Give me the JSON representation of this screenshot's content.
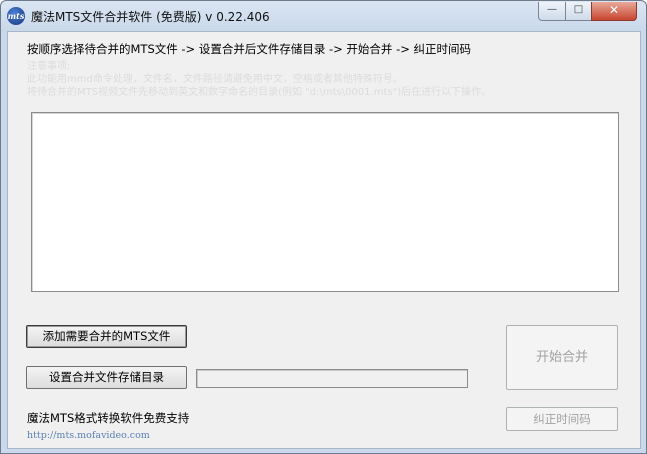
{
  "window": {
    "title": "魔法MTS文件合并软件 (免费版) v 0.22.406",
    "icon": "mts-logo-icon",
    "icon_text": "mts",
    "controls": {
      "minimize_glyph": "—",
      "maximize_glyph": "□",
      "close_glyph": "✕"
    }
  },
  "main": {
    "instructions": "按顺序选择待合并的MTS文件 -> 设置合并后文件存储目录  -> 开始合并 -> 纠正时间码",
    "notes": [
      "注意事项:",
      "此功能用mmd命令处理，文件名，文件路径请避免用中文，空格或者其他特殊符号。",
      "将待合并的MTS视频文件先移动到英文和数字命名的目录(例如 \"d:\\mts\\0001.mts\")后在进行以下操作。"
    ],
    "log": ""
  },
  "buttons": {
    "add_files": "添加需要合并的MTS文件",
    "set_dir": "设置合并文件存储目录",
    "start": "开始合并",
    "fix_timecode": "纠正时间码"
  },
  "output_path": {
    "value": ""
  },
  "footer": {
    "support": "魔法MTS格式转换软件免费支持",
    "link": "http://mts.mofavideo.com"
  },
  "colors": {
    "disabled_text": "#a2a2a2",
    "link": "#5a7fb5",
    "close_button": "#c7452f"
  }
}
